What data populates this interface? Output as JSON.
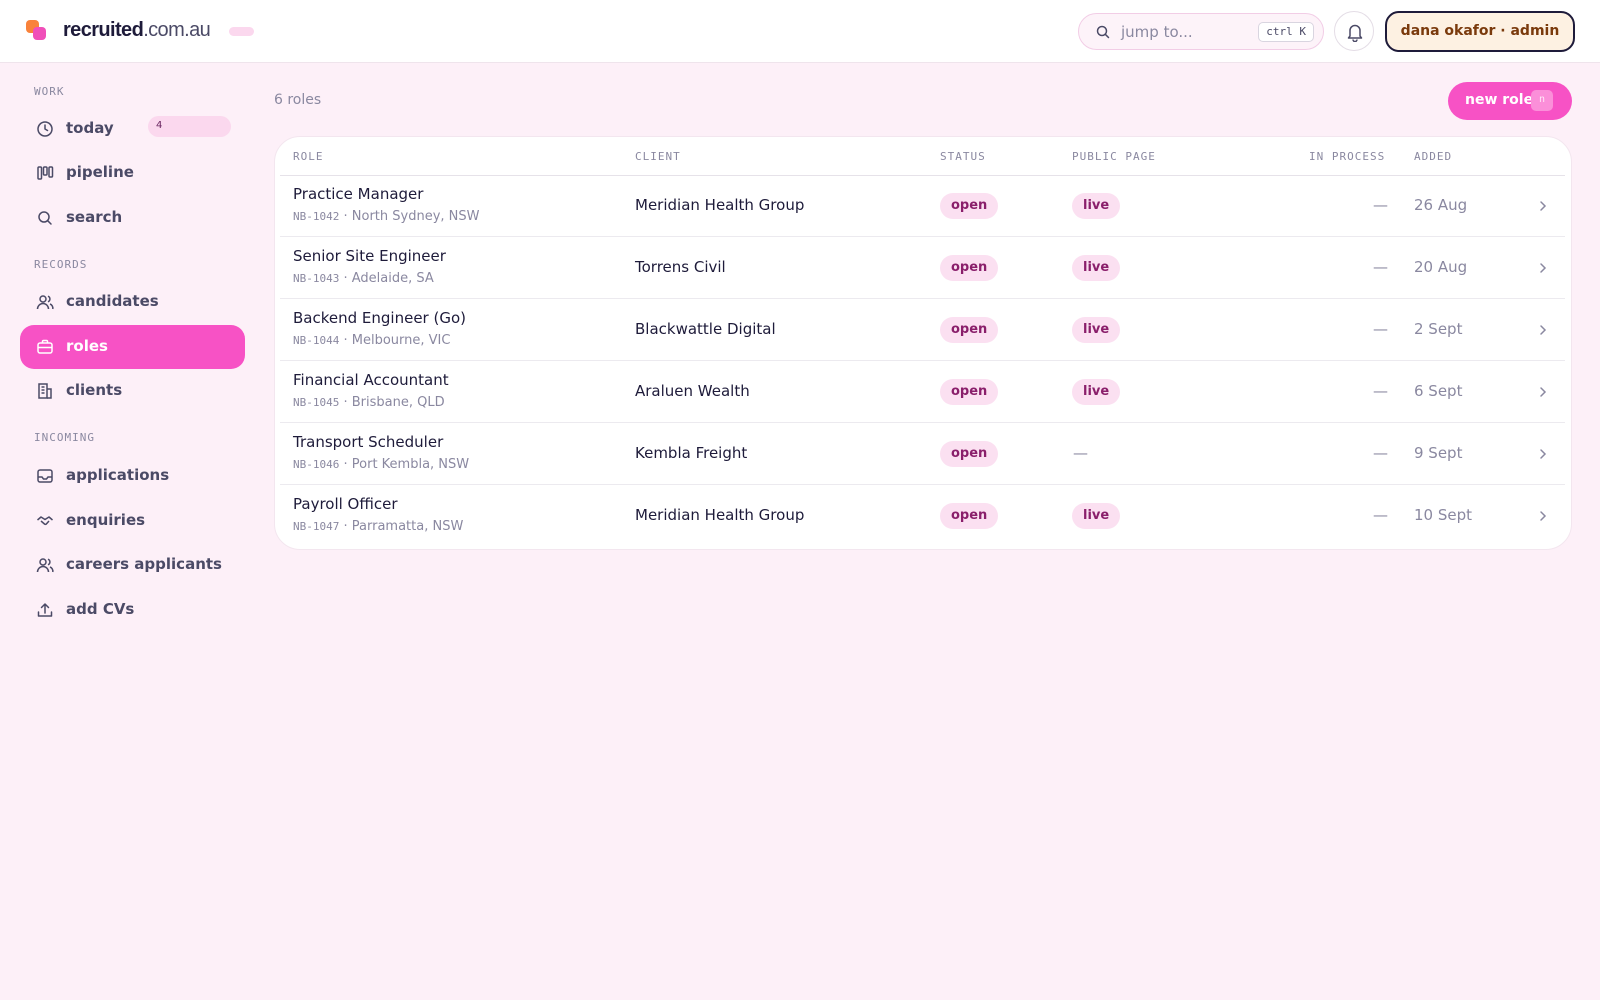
{
  "brand": {
    "name_bold": "recruited",
    "name_rest": ".com.au"
  },
  "header": {
    "search_placeholder": "jump to...",
    "search_shortcut": "ctrl K",
    "user_label": "dana okafor · admin"
  },
  "sidebar": {
    "sections": [
      {
        "label": "WORK"
      },
      {
        "label": "RECORDS"
      },
      {
        "label": "INCOMING"
      }
    ],
    "items": [
      {
        "label": "today",
        "icon": "clock-icon",
        "count": "4"
      },
      {
        "label": "pipeline",
        "icon": "kanban-icon"
      },
      {
        "label": "search",
        "icon": "search-icon"
      },
      {
        "label": "candidates",
        "icon": "users-icon"
      },
      {
        "label": "roles",
        "icon": "briefcase-icon",
        "active": true
      },
      {
        "label": "clients",
        "icon": "building-icon"
      },
      {
        "label": "applications",
        "icon": "inbox-icon"
      },
      {
        "label": "enquiries",
        "icon": "handshake-icon"
      },
      {
        "label": "careers applicants",
        "icon": "users-icon"
      },
      {
        "label": "add CVs",
        "icon": "upload-icon"
      }
    ]
  },
  "main": {
    "count_label": "6 roles",
    "new_button_label": "new role",
    "new_button_shortcut": "n",
    "columns": {
      "role": "ROLE",
      "client": "CLIENT",
      "status": "STATUS",
      "public": "PUBLIC PAGE",
      "in_process": "IN PROCESS",
      "added": "ADDED"
    },
    "rows": [
      {
        "title": "Practice Manager",
        "code": "NB-1042",
        "location": "North Sydney, NSW",
        "client": "Meridian Health Group",
        "status": "open",
        "public": "live",
        "in_process": "—",
        "added": "26 Aug"
      },
      {
        "title": "Senior Site Engineer",
        "code": "NB-1043",
        "location": "Adelaide, SA",
        "client": "Torrens Civil",
        "status": "open",
        "public": "live",
        "in_process": "—",
        "added": "20 Aug"
      },
      {
        "title": "Backend Engineer (Go)",
        "code": "NB-1044",
        "location": "Melbourne, VIC",
        "client": "Blackwattle Digital",
        "status": "open",
        "public": "live",
        "in_process": "—",
        "added": "2 Sept"
      },
      {
        "title": "Financial Accountant",
        "code": "NB-1045",
        "location": "Brisbane, QLD",
        "client": "Araluen Wealth",
        "status": "open",
        "public": "live",
        "in_process": "—",
        "added": "6 Sept"
      },
      {
        "title": "Transport Scheduler",
        "code": "NB-1046",
        "location": "Port Kembla, NSW",
        "client": "Kembla Freight",
        "status": "open",
        "public": "—",
        "in_process": "—",
        "added": "9 Sept"
      },
      {
        "title": "Payroll Officer",
        "code": "NB-1047",
        "location": "Parramatta, NSW",
        "client": "Meridian Health Group",
        "status": "open",
        "public": "live",
        "in_process": "—",
        "added": "10 Sept"
      }
    ]
  },
  "colors": {
    "accent": "#f752c5",
    "background": "#fdf0f8",
    "badge_bg": "#fbe0f1",
    "badge_text": "#8a1f6b"
  }
}
